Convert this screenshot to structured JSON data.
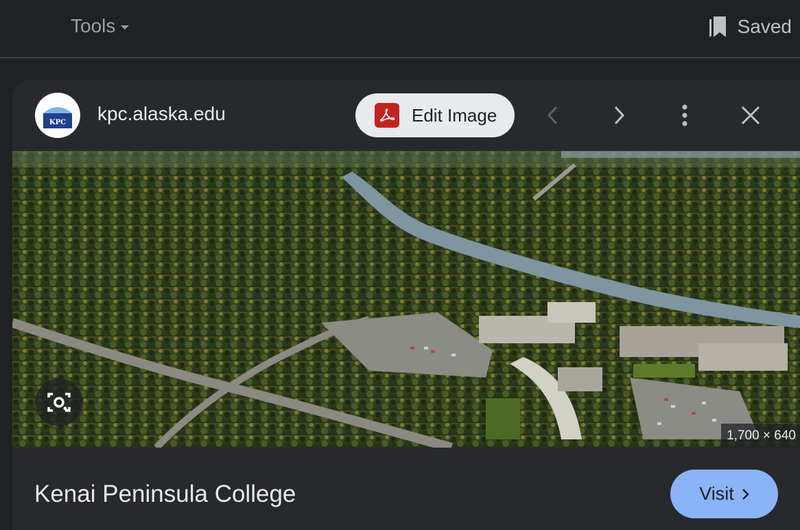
{
  "topbar": {
    "tools_label": "Tools",
    "saved_label": "Saved",
    "icons": {
      "tools_caret": "caret-down-icon",
      "saved": "bookmark-icon"
    }
  },
  "result": {
    "favicon_text": "KPC",
    "domain": "kpc.alaska.edu",
    "edit_button_label": "Edit Image",
    "title": "Kenai Peninsula College",
    "dimensions": "1,700 × 640",
    "visit_label": "Visit",
    "icons": {
      "edit": "pdf-icon",
      "prev": "chevron-left-icon",
      "next": "chevron-right-icon",
      "more": "more-vert-icon",
      "close": "close-icon",
      "lens": "lens-icon",
      "visit": "chevron-right-icon"
    }
  },
  "colors": {
    "background": "#202124",
    "card": "#28292c",
    "accent_button": "#8ab4f8",
    "pdf_red": "#c5221f"
  }
}
